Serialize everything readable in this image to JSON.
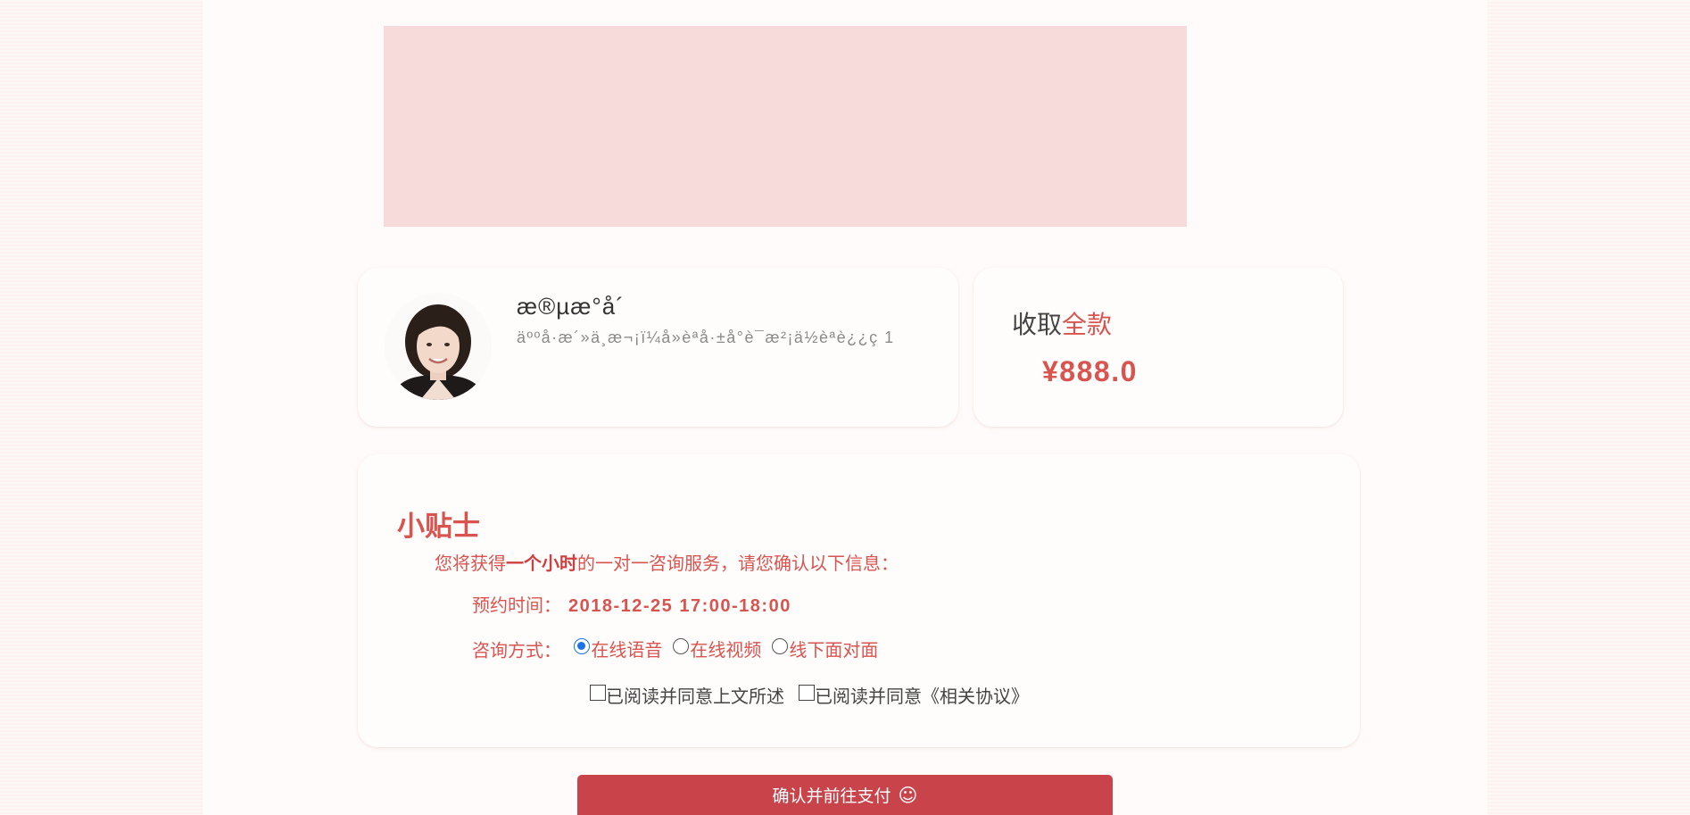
{
  "banner": {},
  "doctor": {
    "name": "æ®µæ°å´",
    "description": "äººå·æ´»ä¸æ¬¡ï¼å»èªå·±å°è¯æ²¡ä½èªè¿¿ç 1",
    "avatar_icon": "doctor-portrait"
  },
  "fee": {
    "label_prefix": "收取",
    "label_accent": "全款",
    "price": "¥888.0",
    "accent_color": "#d9534f"
  },
  "tips": {
    "title": "小贴士",
    "intro_before": "您将获得",
    "intro_bold": "一个小时",
    "intro_after": "的一对一咨询服务，请您确认以下信息：",
    "time_label": "预约时间：",
    "time_value": "2018-12-25 17:00-18:00",
    "mode_label": "咨询方式：",
    "modes": [
      {
        "label": "在线语音",
        "checked": true
      },
      {
        "label": "在线视频",
        "checked": false
      },
      {
        "label": "线下面对面",
        "checked": false
      }
    ],
    "agreements": [
      {
        "label": "已阅读并同意上文所述",
        "checked": false
      },
      {
        "label": "已阅读并同意《相关协议》",
        "checked": false
      }
    ]
  },
  "confirm": {
    "label": "确认并前往支付",
    "icon": "smile-icon",
    "icon_glyph": "☺",
    "color": "#c9444a"
  }
}
